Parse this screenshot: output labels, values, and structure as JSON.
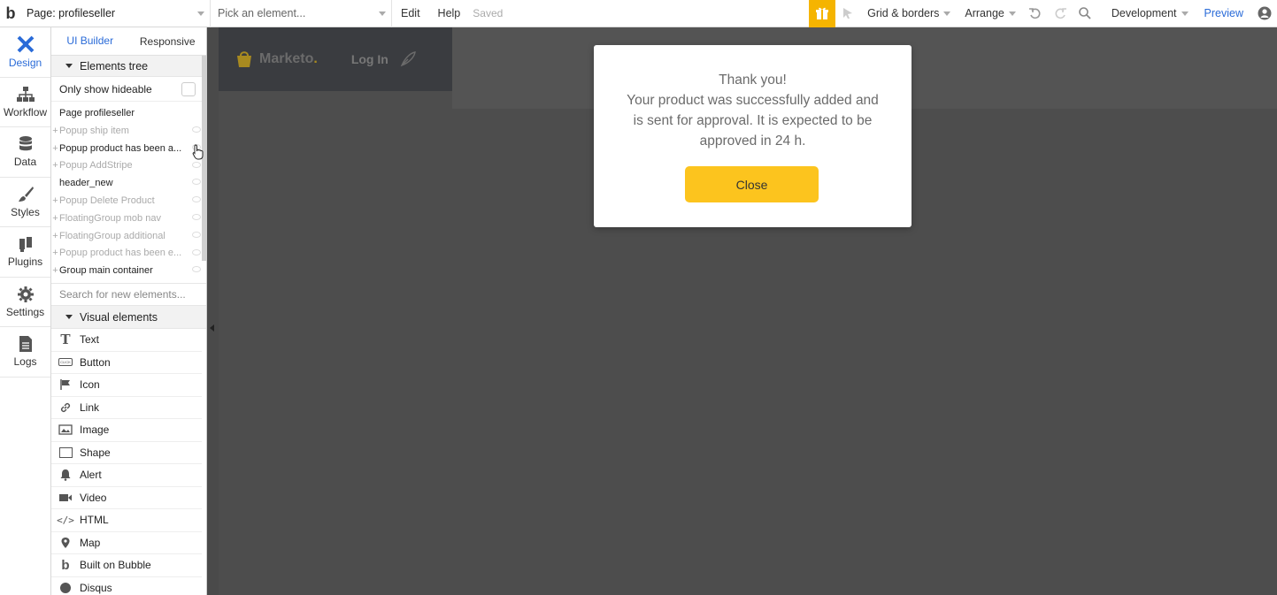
{
  "topbar": {
    "page_label": "Page: profileseller",
    "element_placeholder": "Pick an element...",
    "menu": [
      "Edit",
      "Help"
    ],
    "saved": "Saved",
    "grid_label": "Grid & borders",
    "arrange_label": "Arrange",
    "env_label": "Development",
    "preview_label": "Preview",
    "accent": "#f5b400"
  },
  "rail": [
    {
      "label": "Design",
      "icon": "design-icon"
    },
    {
      "label": "Workflow",
      "icon": "workflow-icon"
    },
    {
      "label": "Data",
      "icon": "database-icon"
    },
    {
      "label": "Styles",
      "icon": "brush-icon"
    },
    {
      "label": "Plugins",
      "icon": "plug-icon"
    },
    {
      "label": "Settings",
      "icon": "gear-icon"
    },
    {
      "label": "Logs",
      "icon": "document-icon"
    }
  ],
  "panel": {
    "tabs": [
      "UI Builder",
      "Responsive"
    ],
    "elements_tree_title": "Elements tree",
    "only_hideable": "Only show hideable",
    "page_node": "Page profileseller",
    "tree": [
      {
        "label": "Popup ship item",
        "muted": true,
        "plus": true
      },
      {
        "label": "Popup product has been a...",
        "muted": false,
        "plus": true
      },
      {
        "label": "Popup AddStripe",
        "muted": true,
        "plus": true
      },
      {
        "label": "header_new",
        "muted": false,
        "plus": false
      },
      {
        "label": "Popup Delete Product",
        "muted": true,
        "plus": true
      },
      {
        "label": "FloatingGroup mob nav",
        "muted": true,
        "plus": true
      },
      {
        "label": "FloatingGroup additional",
        "muted": true,
        "plus": true
      },
      {
        "label": "Popup product has been e...",
        "muted": true,
        "plus": true
      },
      {
        "label": "Group main container",
        "muted": false,
        "plus": true
      }
    ],
    "search_placeholder": "Search for new elements...",
    "visual_title": "Visual elements",
    "visual_items": [
      {
        "label": "Text",
        "icon": "text-icon"
      },
      {
        "label": "Button",
        "icon": "button-icon"
      },
      {
        "label": "Icon",
        "icon": "flag-icon"
      },
      {
        "label": "Link",
        "icon": "link-icon"
      },
      {
        "label": "Image",
        "icon": "image-icon"
      },
      {
        "label": "Shape",
        "icon": "shape-icon"
      },
      {
        "label": "Alert",
        "icon": "bell-icon"
      },
      {
        "label": "Video",
        "icon": "video-icon"
      },
      {
        "label": "HTML",
        "icon": "code-icon"
      },
      {
        "label": "Map",
        "icon": "map-pin-icon"
      },
      {
        "label": "Built on Bubble",
        "icon": "bubble-icon"
      },
      {
        "label": "Disqus",
        "icon": "chat-icon"
      }
    ]
  },
  "canvas": {
    "brand": "Marketo",
    "brand_dot": ".",
    "login": "Log In",
    "popup": {
      "line1": "Thank you!",
      "line2": "Your product was successfully added and",
      "line3": "is sent for approval. It is expected to be",
      "line4": "approved in 24 h.",
      "button": "Close",
      "button_color": "#fcc41e"
    }
  }
}
